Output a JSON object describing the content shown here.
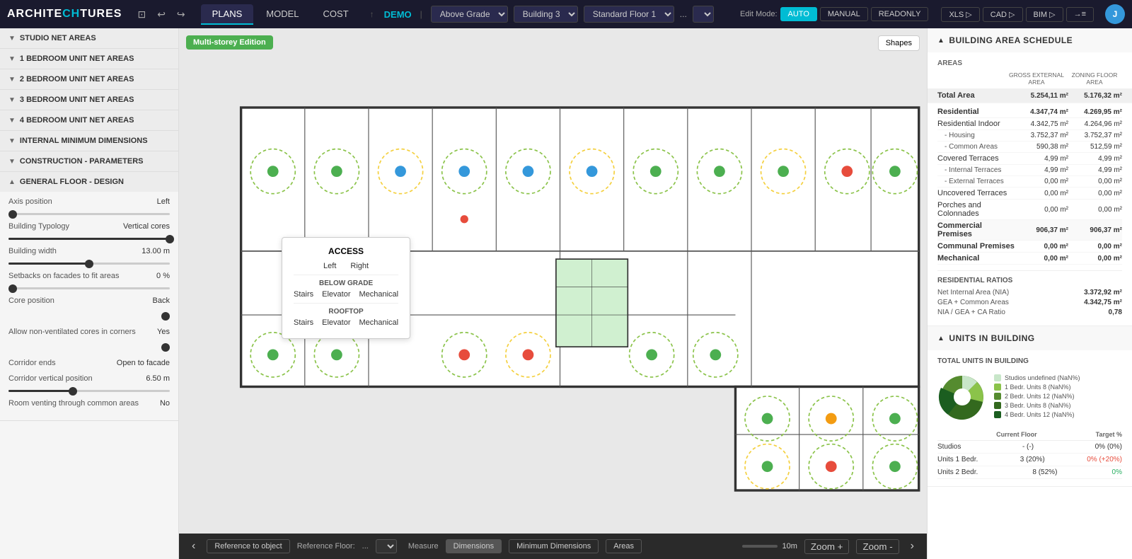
{
  "topbar": {
    "logo": "ARCHITECHTURES",
    "icons": [
      "save",
      "undo",
      "redo"
    ],
    "tabs": [
      "PLANS",
      "MODEL",
      "COST"
    ],
    "active_tab": "PLANS",
    "project": "DEMO",
    "grade": "Above Grade",
    "building": "Building 3",
    "floor": "Standard Floor 1",
    "more": "...",
    "edit_mode_label": "Edit Mode:",
    "edit_modes": [
      "AUTO",
      "MANUAL",
      "READONLY"
    ],
    "active_mode": "AUTO",
    "exports": [
      "XLS ▷",
      "CAD ▷",
      "BIM ▷",
      "→≡"
    ],
    "user_initial": "J"
  },
  "left_sidebar": {
    "sections": [
      {
        "id": "studio",
        "label": "STUDIO NET AREAS",
        "open": false
      },
      {
        "id": "1bed",
        "label": "1 BEDROOM UNIT NET AREAS",
        "open": false
      },
      {
        "id": "2bed",
        "label": "2 BEDROOM UNIT NET AREAS",
        "open": false
      },
      {
        "id": "3bed",
        "label": "3 BEDROOM UNIT NET AREAS",
        "open": false
      },
      {
        "id": "4bed",
        "label": "4 BEDROOM UNIT NET AREAS",
        "open": false
      },
      {
        "id": "internal",
        "label": "INTERNAL MINIMUM DIMENSIONS",
        "open": false
      },
      {
        "id": "construction",
        "label": "CONSTRUCTION - PARAMETERS",
        "open": false
      },
      {
        "id": "general",
        "label": "GENERAL FLOOR - DESIGN",
        "open": true
      }
    ],
    "general_floor": {
      "axis_position_label": "Axis position",
      "axis_position_value": "Left",
      "building_typology_label": "Building Typology",
      "building_typology_value": "Vertical cores",
      "building_width_label": "Building width",
      "building_width_value": "13.00  m",
      "building_width_slider": 50,
      "setbacks_label": "Setbacks on facades to fit areas",
      "setbacks_value": "0  %",
      "setbacks_slider": 0,
      "core_position_label": "Core position",
      "core_position_value": "Back",
      "allow_non_ventilated_label": "Allow non-ventilated cores in corners",
      "allow_non_ventilated_value": "Yes",
      "corridor_ends_label": "Corridor ends",
      "corridor_ends_value": "Open to facade",
      "corridor_vertical_label": "Corridor vertical position",
      "corridor_vertical_value": "6.50  m",
      "corridor_vertical_slider": 40,
      "room_venting_label": "Room venting through common areas",
      "room_venting_value": "No"
    }
  },
  "canvas": {
    "badge": "Multi-storey Edition",
    "shapes_btn": "Shapes"
  },
  "access_popup": {
    "title": "ACCESS",
    "options": [
      "Left",
      "Right"
    ],
    "below_grade_label": "BELOW GRADE",
    "below_grade_options": [
      "Stairs",
      "Elevator",
      "Mechanical"
    ],
    "rooftop_label": "ROOFTOP",
    "rooftop_options": [
      "Stairs",
      "Elevator",
      "Mechanical"
    ]
  },
  "bottom_bar": {
    "reference_label": "Reference to object",
    "reference_floor_label": "Reference Floor:",
    "reference_floor_value": "...",
    "measure_label": "Measure",
    "buttons": [
      "Dimensions",
      "Minimum Dimensions",
      "Areas"
    ],
    "zoom_plus": "Zoom +",
    "zoom_minus": "Zoom -",
    "scale_label": "10m"
  },
  "right_panel": {
    "building_area_schedule": {
      "header": "BUILDING AREA SCHEDULE",
      "areas_label": "AREAS",
      "col_headers": [
        "GROSS EXTERNAL AREA",
        "ZONING FLOOR AREA"
      ],
      "total_area_label": "Total Area",
      "total_gross": "5.254,11 m²",
      "total_zoning": "5.176,32 m²",
      "rows": [
        {
          "label": "Residential",
          "gross": "4.347,74 m²",
          "zoning": "4.269,95 m²",
          "bold": true
        },
        {
          "label": "Residential Indoor",
          "gross": "4.342,75 m²",
          "zoning": "4.264,96 m²",
          "indent": false
        },
        {
          "label": "- Housing",
          "gross": "3.752,37 m²",
          "zoning": "3.752,37 m²",
          "indent": true
        },
        {
          "label": "- Common Areas",
          "gross": "590,38 m²",
          "zoning": "512,59 m²",
          "indent": true
        },
        {
          "label": "Covered Terraces",
          "gross": "4,99 m²",
          "zoning": "4,99 m²",
          "indent": false
        },
        {
          "label": "- Internal Terraces",
          "gross": "4,99 m²",
          "zoning": "4,99 m²",
          "indent": true
        },
        {
          "label": "- External Terraces",
          "gross": "0,00 m²",
          "zoning": "0,00 m²",
          "indent": true
        },
        {
          "label": "Uncovered Terraces",
          "gross": "0,00 m²",
          "zoning": "0,00 m²",
          "indent": false
        },
        {
          "label": "Porches and Colonnades",
          "gross": "0,00 m²",
          "zoning": "0,00 m²",
          "indent": false
        },
        {
          "label": "Commercial Premises",
          "gross": "906,37 m²",
          "zoning": "906,37 m²",
          "bold": true,
          "highlight": true
        },
        {
          "label": "Communal Premises",
          "gross": "0,00 m²",
          "zoning": "0,00 m²",
          "bold": true
        },
        {
          "label": "Mechanical",
          "gross": "0,00 m²",
          "zoning": "0,00 m²",
          "bold": true
        }
      ],
      "ratios": {
        "label": "RESIDENTIAL RATIOS",
        "nia_label": "Net Internal Area (NIA)",
        "nia_value": "3.372,92 m²",
        "gea_label": "GEA + Common Areas",
        "gea_value": "4.342,75 m²",
        "ratio_label": "NIA / GEA + CA Ratio",
        "ratio_value": "0,78"
      }
    },
    "units_in_building": {
      "header": "UNITS IN BUILDING",
      "total_label": "TOTAL UNITS IN BUILDING",
      "chart_data": [
        {
          "label": "Studios undefined (NaN%)",
          "color": "#c8e6c9",
          "value": 10,
          "offset": 0
        },
        {
          "label": "1 Bedr. Units 8 (NaN%)",
          "color": "#8bc34a",
          "value": 20,
          "offset": 10
        },
        {
          "label": "2 Bedr. Units 12 (NaN%)",
          "color": "#558b2f",
          "value": 30,
          "offset": 30
        },
        {
          "label": "3 Bedr. Units 8 (NaN%)",
          "color": "#33691e",
          "value": 25,
          "offset": 60
        },
        {
          "label": "4 Bedr. Units 12 (NaN%)",
          "color": "#1b5e20",
          "value": 15,
          "offset": 85
        }
      ],
      "table_headers": [
        "",
        "Current Floor",
        "Target %"
      ],
      "table_rows": [
        {
          "label": "Studios",
          "current": "- (-)",
          "target": "0% (0%)"
        },
        {
          "label": "Units 1 Bedr.",
          "current": "3 (20%)",
          "target": "0% (+20%)",
          "target_class": "red"
        },
        {
          "label": "Units 2 Bedr.",
          "current": "8 (52%)",
          "target": "0%",
          "target_class": "green"
        }
      ]
    }
  }
}
